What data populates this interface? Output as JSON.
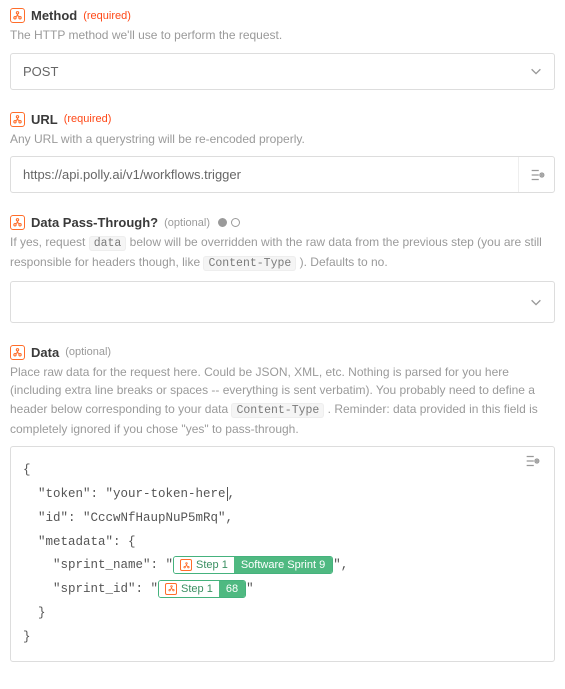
{
  "method": {
    "label": "Method",
    "req": "(required)",
    "help": "The HTTP method we'll use to perform the request.",
    "value": "POST"
  },
  "url": {
    "label": "URL",
    "req": "(required)",
    "help": "Any URL with a querystring will be re-encoded properly.",
    "value": "https://api.polly.ai/v1/workflows.trigger"
  },
  "passthrough": {
    "label": "Data Pass-Through?",
    "opt": "(optional)",
    "help_pre": "If yes, request ",
    "help_code1": "data",
    "help_mid": " below will be overridden with the raw data from the previous step (you are still responsible for headers though, like ",
    "help_code2": "Content-Type",
    "help_post": " ). Defaults to no.",
    "value": ""
  },
  "data": {
    "label": "Data",
    "opt": "(optional)",
    "help_pre": "Place raw data for the request here. Could be JSON, XML, etc. Nothing is parsed for you here (including extra line breaks or spaces -- everything is sent verbatim). You probably need to define a header below corresponding to your data ",
    "help_code1": "Content-Type",
    "help_post": " . Reminder: data provided in this field is completely ignored if you chose \"yes\" to pass-through.",
    "body": {
      "l1": "{",
      "l2a": "  \"token\": \"your-token-here",
      "l2b": ",",
      "l3": "  \"id\": \"CccwNfHaupNuP5mRq\",",
      "l4": "  \"metadata\": {",
      "l5a": "    \"sprint_name\": \"",
      "l5b": "\",",
      "l6a": "    \"sprint_id\": \"",
      "l6b": "\"",
      "l7": "  }",
      "l8": "}"
    },
    "pill1_step": "Step 1",
    "pill1_val": "Software Sprint 9",
    "pill2_step": "Step 1",
    "pill2_val": "68"
  }
}
